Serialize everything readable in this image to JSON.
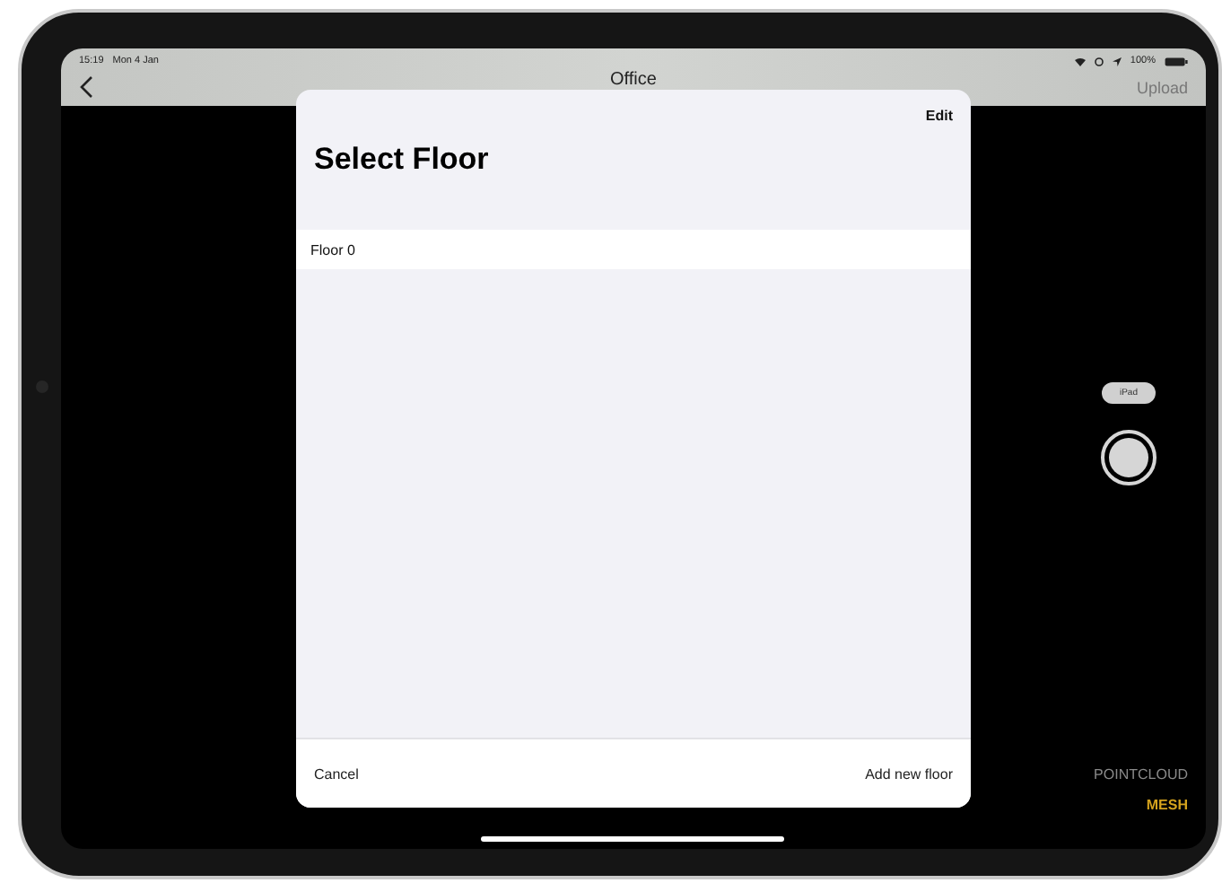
{
  "status_bar": {
    "time": "15:19",
    "date": "Mon 4 Jan",
    "battery": "100%"
  },
  "nav_bar": {
    "title": "Office",
    "action": "Upload"
  },
  "camera": {
    "device_label": "iPad",
    "modes": [
      {
        "label": "POINTCLOUD",
        "selected": false
      },
      {
        "label": "MESH",
        "selected": true
      }
    ]
  },
  "sheet": {
    "title": "Select Floor",
    "edit": "Edit",
    "floors": [
      {
        "name": "Floor 0"
      }
    ],
    "cancel": "Cancel",
    "add": "Add new floor"
  }
}
